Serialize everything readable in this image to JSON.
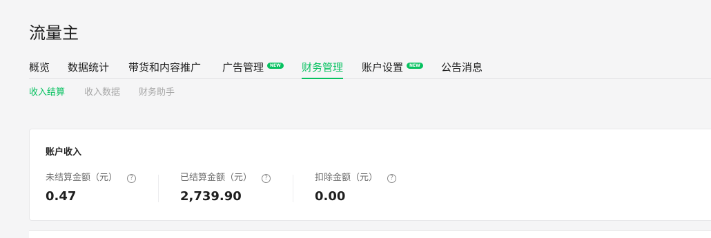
{
  "page": {
    "title": "流量主"
  },
  "main_tabs": [
    {
      "label": "概览",
      "badge": null
    },
    {
      "label": "数据统计",
      "badge": null
    },
    {
      "label": "带货和内容推广",
      "badge": null
    },
    {
      "label": "广告管理",
      "badge": "NEW"
    },
    {
      "label": "财务管理",
      "badge": null,
      "active": true
    },
    {
      "label": "账户设置",
      "badge": "NEW"
    },
    {
      "label": "公告消息",
      "badge": null
    }
  ],
  "sub_tabs": [
    {
      "label": "收入结算",
      "active": true
    },
    {
      "label": "收入数据"
    },
    {
      "label": "财务助手"
    }
  ],
  "account_income": {
    "title": "账户收入",
    "metrics": [
      {
        "label": "未结算金额（元）",
        "value": "0.47"
      },
      {
        "label": "已结算金额（元）",
        "value": "2,739.90"
      },
      {
        "label": "扣除金额（元）",
        "value": "0.00"
      }
    ]
  },
  "colors": {
    "accent": "#07c160",
    "background": "#f5f5f6",
    "text_primary": "#1f1f1f",
    "text_muted": "#a6a6a6"
  },
  "icons": {
    "help": "question-circle-icon"
  }
}
